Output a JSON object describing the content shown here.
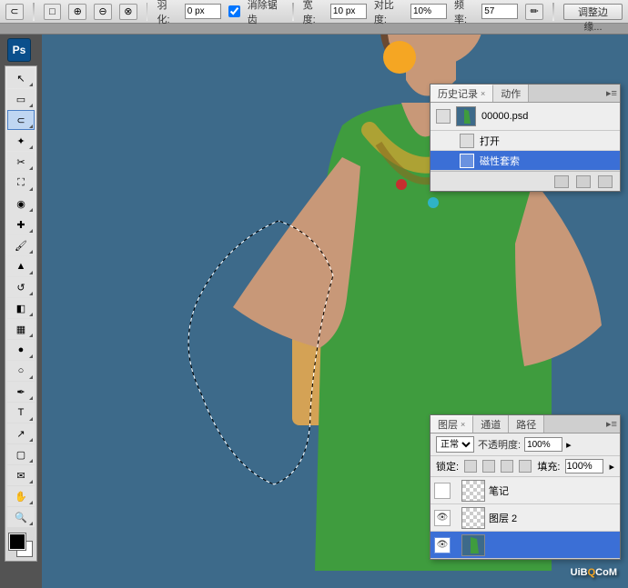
{
  "topbar": {
    "feather_label": "羽化:",
    "feather_value": "0 px",
    "antialias_label": "消除锯齿",
    "antialias_checked": true,
    "width_label": "宽度:",
    "width_value": "10 px",
    "contrast_label": "对比度:",
    "contrast_value": "10%",
    "frequency_label": "频率:",
    "frequency_value": "57",
    "refine_label": "调整边缘..."
  },
  "app_badge": "Ps",
  "tools": [
    {
      "name": "move",
      "glyph": "↖"
    },
    {
      "name": "marquee",
      "glyph": "▭"
    },
    {
      "name": "lasso",
      "glyph": "⊂",
      "selected": true
    },
    {
      "name": "magic-wand",
      "glyph": "✦"
    },
    {
      "name": "crop",
      "glyph": "✂"
    },
    {
      "name": "slice",
      "glyph": "⛶"
    },
    {
      "name": "eyedrop",
      "glyph": "◉"
    },
    {
      "name": "healing",
      "glyph": "✚"
    },
    {
      "name": "brush",
      "glyph": "🖌"
    },
    {
      "name": "stamp",
      "glyph": "▲"
    },
    {
      "name": "history-brush",
      "glyph": "↺"
    },
    {
      "name": "eraser",
      "glyph": "◧"
    },
    {
      "name": "gradient",
      "glyph": "▦"
    },
    {
      "name": "blur",
      "glyph": "●"
    },
    {
      "name": "dodge",
      "glyph": "○"
    },
    {
      "name": "pen",
      "glyph": "✒"
    },
    {
      "name": "text",
      "glyph": "T"
    },
    {
      "name": "path",
      "glyph": "↗"
    },
    {
      "name": "shape",
      "glyph": "▢"
    },
    {
      "name": "notes",
      "glyph": "✉"
    },
    {
      "name": "hand",
      "glyph": "✋"
    },
    {
      "name": "zoom",
      "glyph": "🔍"
    }
  ],
  "history_panel": {
    "tab1": "历史记录",
    "tab2": "动作",
    "doc_name": "00000.psd",
    "items": [
      {
        "label": "打开",
        "selected": false
      },
      {
        "label": "磁性套索",
        "selected": true
      }
    ]
  },
  "layers_panel": {
    "tab1": "图层",
    "tab2": "通道",
    "tab3": "路径",
    "blend_mode": "正常",
    "opacity_label": "不透明度:",
    "opacity_value": "100%",
    "lock_label": "锁定:",
    "fill_label": "填充:",
    "fill_value": "100%",
    "layers": [
      {
        "name": "笔记",
        "visible": false,
        "selected": false,
        "thumb": "checker"
      },
      {
        "name": "图层 2",
        "visible": true,
        "selected": false,
        "thumb": "checker"
      },
      {
        "name": "",
        "visible": true,
        "selected": true,
        "thumb": "image"
      }
    ]
  },
  "watermark": {
    "pre": "UiB",
    "o": "Q",
    ".": ".",
    "post": "CoM"
  }
}
